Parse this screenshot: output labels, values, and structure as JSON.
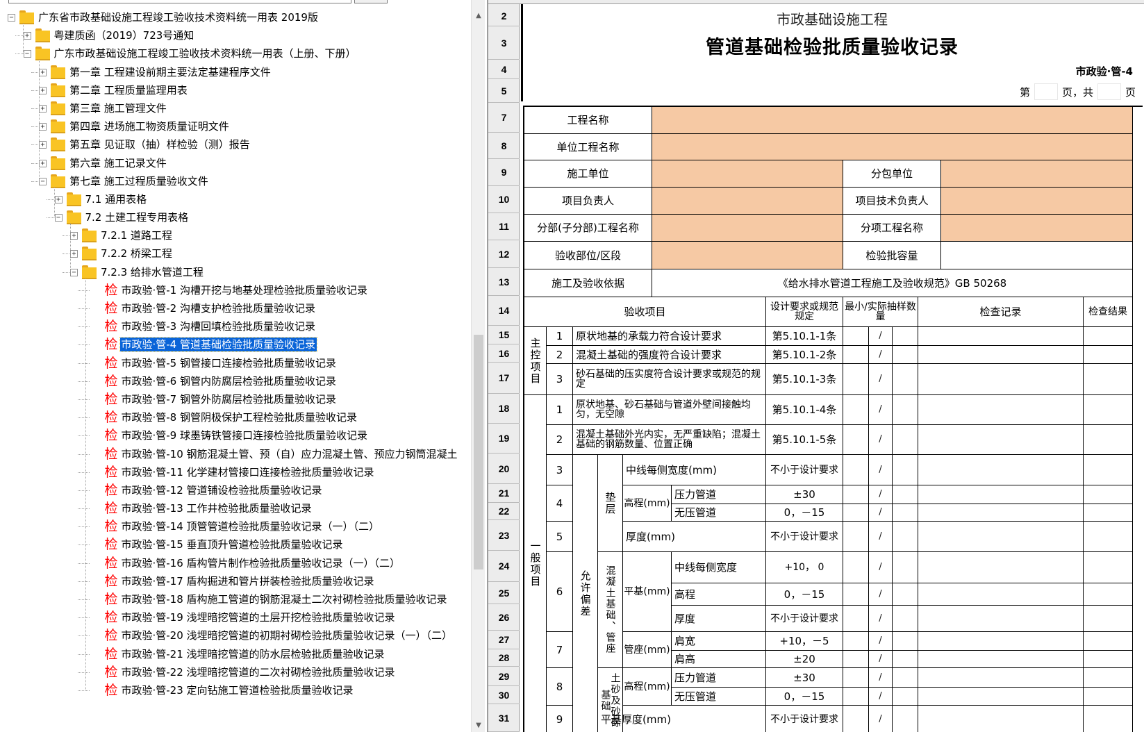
{
  "tree": {
    "items": [
      {
        "level": 0,
        "type": "folder",
        "toggle": "−",
        "label": "广东省市政基础设施工程竣工验收技术资料统一用表 2019版"
      },
      {
        "level": 1,
        "type": "folder",
        "toggle": "+",
        "label": "粤建质函（2019）723号通知"
      },
      {
        "level": 1,
        "type": "folder",
        "toggle": "−",
        "label": "广东市政基础设施工程竣工验收技术资料统一用表（上册、下册）"
      },
      {
        "level": 2,
        "type": "folder",
        "toggle": "+",
        "label": "第一章  工程建设前期主要法定基建程序文件"
      },
      {
        "level": 2,
        "type": "folder",
        "toggle": "+",
        "label": "第二章  工程质量监理用表"
      },
      {
        "level": 2,
        "type": "folder",
        "toggle": "+",
        "label": "第三章  施工管理文件"
      },
      {
        "level": 2,
        "type": "folder",
        "toggle": "+",
        "label": "第四章  进场施工物资质量证明文件"
      },
      {
        "level": 2,
        "type": "folder",
        "toggle": "+",
        "label": "第五章  见证取（抽）样检验（测）报告"
      },
      {
        "level": 2,
        "type": "folder",
        "toggle": "+",
        "label": "第六章  施工记录文件"
      },
      {
        "level": 2,
        "type": "folder",
        "toggle": "−",
        "label": "第七章  施工过程质量验收文件"
      },
      {
        "level": 3,
        "type": "folder",
        "toggle": "+",
        "label": "7.1  通用表格"
      },
      {
        "level": 3,
        "type": "folder",
        "toggle": "−",
        "label": "7.2  土建工程专用表格"
      },
      {
        "level": 4,
        "type": "folder",
        "toggle": "+",
        "label": "7.2.1  道路工程"
      },
      {
        "level": 4,
        "type": "folder",
        "toggle": "+",
        "label": "7.2.2  桥梁工程"
      },
      {
        "level": 4,
        "type": "folder",
        "toggle": "−",
        "label": "7.2.3  给排水管道工程"
      },
      {
        "level": 5,
        "type": "doc",
        "glyph": "检",
        "label": "市政验·管-1  沟槽开挖与地基处理检验批质量验收记录"
      },
      {
        "level": 5,
        "type": "doc",
        "glyph": "检",
        "label": "市政验·管-2  沟槽支护检验批质量验收记录"
      },
      {
        "level": 5,
        "type": "doc",
        "glyph": "检",
        "label": "市政验·管-3  沟槽回填检验批质量验收记录"
      },
      {
        "level": 5,
        "type": "doc",
        "glyph": "检",
        "label": "市政验·管-4  管道基础检验批质量验收记录",
        "selected": true
      },
      {
        "level": 5,
        "type": "doc",
        "glyph": "检",
        "label": "市政验·管-5  钢管接口连接检验批质量验收记录"
      },
      {
        "level": 5,
        "type": "doc",
        "glyph": "检",
        "label": "市政验·管-6  钢管内防腐层检验批质量验收记录"
      },
      {
        "level": 5,
        "type": "doc",
        "glyph": "检",
        "label": "市政验·管-7  钢管外防腐层检验批质量验收记录"
      },
      {
        "level": 5,
        "type": "doc",
        "glyph": "检",
        "label": "市政验·管-8  钢管阴极保护工程检验批质量验收记录"
      },
      {
        "level": 5,
        "type": "doc",
        "glyph": "检",
        "label": "市政验·管-9  球墨铸铁管接口连接检验批质量验收记录"
      },
      {
        "level": 5,
        "type": "doc",
        "glyph": "检",
        "label": "市政验·管-10  钢筋混凝土管、预（自）应力混凝土管、预应力钢筒混凝土"
      },
      {
        "level": 5,
        "type": "doc",
        "glyph": "检",
        "label": "市政验·管-11  化学建材管接口连接检验批质量验收记录"
      },
      {
        "level": 5,
        "type": "doc",
        "glyph": "检",
        "label": "市政验·管-12  管道铺设检验批质量验收记录"
      },
      {
        "level": 5,
        "type": "doc",
        "glyph": "检",
        "label": "市政验·管-13  工作井检验批质量验收记录"
      },
      {
        "level": 5,
        "type": "doc",
        "glyph": "检",
        "label": "市政验·管-14  顶管管道检验批质量验收记录（一）（二）"
      },
      {
        "level": 5,
        "type": "doc",
        "glyph": "检",
        "label": "市政验·管-15  垂直顶升管道检验批质量验收记录"
      },
      {
        "level": 5,
        "type": "doc",
        "glyph": "检",
        "label": "市政验·管-16  盾构管片制作检验批质量验收记录（一）（二）"
      },
      {
        "level": 5,
        "type": "doc",
        "glyph": "检",
        "label": "市政验·管-17  盾构掘进和管片拼装检验批质量验收记录"
      },
      {
        "level": 5,
        "type": "doc",
        "glyph": "检",
        "label": "市政验·管-18  盾构施工管道的钢筋混凝土二次衬砌检验批质量验收记录"
      },
      {
        "level": 5,
        "type": "doc",
        "glyph": "检",
        "label": "市政验·管-19  浅埋暗挖管道的土层开挖检验批质量验收记录"
      },
      {
        "level": 5,
        "type": "doc",
        "glyph": "检",
        "label": "市政验·管-20  浅埋暗挖管道的初期衬砌检验批质量验收记录（一）（二）"
      },
      {
        "level": 5,
        "type": "doc",
        "glyph": "检",
        "label": "市政验·管-21  浅埋暗挖管道的防水层检验批质量验收记录"
      },
      {
        "level": 5,
        "type": "doc",
        "glyph": "检",
        "label": "市政验·管-22  浅埋暗挖管道的二次衬砌检验批质量验收记录"
      },
      {
        "level": 5,
        "type": "doc",
        "glyph": "检",
        "label": "市政验·管-23  定向钻施工管道检验批质量验收记录"
      }
    ],
    "scroll_up_icon": "▲",
    "scroll_down_icon": "▼"
  },
  "sheet": {
    "row_numbers": [
      "2",
      "3",
      "4",
      "5",
      "7",
      "8",
      "9",
      "10",
      "11",
      "12",
      "13",
      "14",
      "15",
      "16",
      "17",
      "18",
      "19",
      "20",
      "21",
      "22",
      "23",
      "24",
      "25",
      "26",
      "27",
      "28",
      "29",
      "30",
      "31"
    ],
    "title_small": "市政基础设施工程",
    "title_large": "管道基础检验批质量验收记录",
    "form_code": "市政验·管-4",
    "page_prefix": "第",
    "page_mid": "页，共",
    "page_suffix": "页",
    "header_fields": {
      "project_name": "工程名称",
      "unit_project_name": "单位工程名称",
      "construction_unit": "施工单位",
      "subcontract_unit": "分包单位",
      "project_manager": "项目负责人",
      "tech_manager": "项目技术负责人",
      "division_name": "分部(子分部)工程名称",
      "subitem_name": "分项工程名称",
      "acceptance_part": "验收部位/区段",
      "batch_capacity": "检验批容量",
      "basis_label": "施工及验收依据",
      "basis_value": "《给水排水管道工程施工及验收规范》GB 50268"
    },
    "columns": {
      "item": "验收项目",
      "design_req": "设计要求或规范规定",
      "sample": "最小/实际抽样数量",
      "record": "检查记录",
      "result": "检查结果"
    },
    "groups": {
      "main": "主控项目",
      "general": "一般项目",
      "deviation": "允许偏差",
      "cushion": "垫层",
      "concrete_base": "混凝土基础、管座",
      "sand_base": "土砂及砂砾基础"
    },
    "main_items": [
      {
        "no": "1",
        "text": "原状地基的承载力符合设计要求",
        "req": "第5.10.1-1条",
        "slash": "/"
      },
      {
        "no": "2",
        "text": "混凝土基础的强度符合设计要求",
        "req": "第5.10.1-2条",
        "slash": "/"
      },
      {
        "no": "3",
        "text": "砂石基础的压实度符合设计要求或规范的规定",
        "req": "第5.10.1-3条",
        "slash": "/"
      }
    ],
    "general_items": [
      {
        "no": "1",
        "text": "原状地基、砂石基础与管道外壁间接触均匀，无空隙",
        "req": "第5.10.1-4条",
        "slash": "/"
      },
      {
        "no": "2",
        "text": "混凝土基础外光内实，无严重缺陷；混凝土基础的钢筋数量、位置正确",
        "req": "第5.10.1-5条",
        "slash": "/"
      }
    ],
    "deviation_items": {
      "r20": {
        "no": "3",
        "text": "中线每侧宽度(mm)",
        "req": "不小于设计要求",
        "slash": "/"
      },
      "r21": {
        "no": "4",
        "sub": "高程(mm)",
        "text": "压力管道",
        "req": "±30",
        "slash": "/"
      },
      "r22": {
        "text": "无压管道",
        "req": "0，－15",
        "slash": "/"
      },
      "r23": {
        "no": "5",
        "text": "厚度(mm)",
        "req": "不小于设计要求",
        "slash": "/"
      },
      "r24": {
        "no": "6",
        "sub": "平基(mm)",
        "text": "中线每侧宽度",
        "req": "+10，  0",
        "slash": "/"
      },
      "r25": {
        "text": "高程",
        "req": "0，－15",
        "slash": "/"
      },
      "r26": {
        "text": "厚度",
        "req": "不小于设计要求",
        "slash": "/"
      },
      "r27": {
        "no": "7",
        "sub": "管座(mm)",
        "text": "肩宽",
        "req": "+10，－5",
        "slash": "/"
      },
      "r28": {
        "text": "肩高",
        "req": "±20",
        "slash": "/"
      },
      "r29": {
        "no": "8",
        "sub": "高程(mm)",
        "text": "压力管道",
        "req": "±30",
        "slash": "/"
      },
      "r30": {
        "text": "无压管道",
        "req": "0，－15",
        "slash": "/"
      },
      "r31": {
        "no": "9",
        "text": "平基厚度(mm)",
        "req": "不小于设计要求",
        "slash": "/"
      }
    },
    "fill_color": "#f6c9a4",
    "selection_color": "#0a64d8"
  }
}
